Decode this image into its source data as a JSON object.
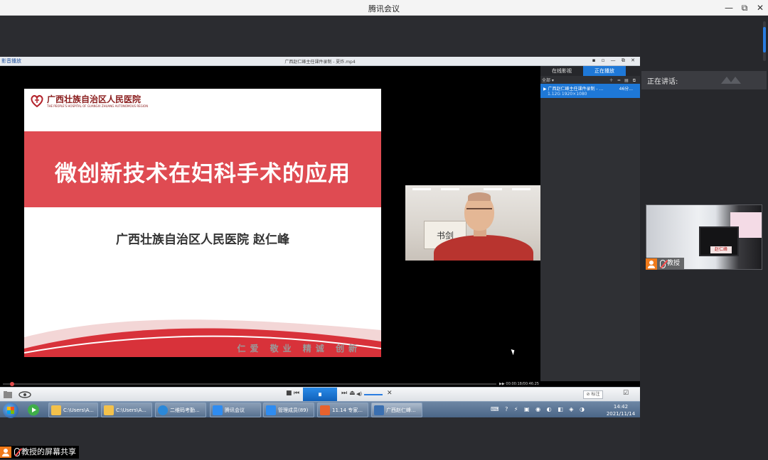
{
  "window": {
    "title": "腾讯会议",
    "minimize": "—",
    "restore": "⧉",
    "close": "✕"
  },
  "player": {
    "brand": "影音播放",
    "file_title": "广西赵仁峰主任课件录制 - 夏炸.mp4",
    "top_buttons": "▪ ▫ — ⧉ ✕",
    "playlist_tabs": [
      "在线影视",
      "正在播放"
    ],
    "playlist_tools": "全部 ▾",
    "playlist_tool_icons": "＋ ━ ▤ ⧉",
    "playlist_item": {
      "title": "▶ 广西赵仁峰主任课件录制 - ...",
      "duration": "46分...",
      "meta": "1.12G    1920×1080"
    },
    "seek_time": "00:00:18/00:46:25",
    "seek_icon": "▶▶",
    "control_buttons": [
      "■",
      "⏮",
      "⏸",
      "⏭",
      "⏏",
      "◀)",
      "✕"
    ],
    "right_control": "⊘ 标注",
    "right_icon": "☑"
  },
  "slide": {
    "hospital_cn": "广西壮族自治区人民医院",
    "hospital_en": "THE PEOPLE'S HOSPITAL OF GUANGXI ZHUANG AUTONOMOUS REGION",
    "title": "微创新技术在妇科手术的应用",
    "author": "广西壮族自治区人民医院  赵仁峰",
    "motto": "仁爱 敬业 精诚 创新"
  },
  "camera": {
    "calligraphy": "书剑"
  },
  "taskbar": {
    "items": [
      {
        "label": "C:\\Users\\A...",
        "color": "#f3c14b"
      },
      {
        "label": "C:\\Users\\A...",
        "color": "#f3c14b"
      },
      {
        "label": "二维码考勤...",
        "color": "#2b88d8"
      },
      {
        "label": "腾讯会议",
        "color": "#2f8cf0"
      },
      {
        "label": "管理成员(89)",
        "color": "#2f8cf0"
      },
      {
        "label": "11.14 专家...",
        "color": "#e8622d"
      },
      {
        "label": "广西赵仁峰...",
        "color": "#3a6fb0"
      }
    ],
    "tray": "⌨ ? ⚡ ▣ ◉ ◐ ◧ ◈ ◑",
    "time": "14:42",
    "date": "2021/11/14"
  },
  "right_panel": {
    "speaking_label": "正在讲话:",
    "participant_label": "教授",
    "nameplate": "赵仁峰"
  },
  "share_label": "教授的屏幕共享",
  "colors": {
    "accent": "#1e78d7",
    "banner_red": "#df4b52",
    "hospital_red": "#8a1c1c",
    "share_icon": "#f07a1a"
  }
}
